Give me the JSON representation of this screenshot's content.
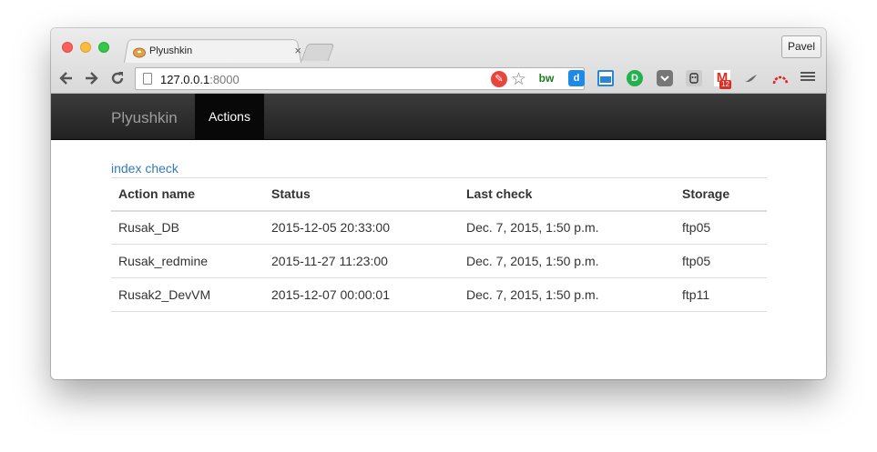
{
  "browser": {
    "tab_title": "Plyushkin",
    "tab_close": "×",
    "profile_name": "Pavel",
    "url_host": "127.0.0.1",
    "url_port": ":8000",
    "icons": {
      "back": "back-arrow-icon",
      "forward": "forward-arrow-icon",
      "reload": "reload-icon",
      "bookmark": "star-icon",
      "menu": "hamburger-menu-icon"
    },
    "extensions": {
      "bw_label": "bw",
      "d_label": "d",
      "circle_label": "D",
      "gmail_label": "M",
      "gmail_badge": "12"
    }
  },
  "navbar": {
    "brand": "Plyushkin",
    "active_item": "Actions"
  },
  "main": {
    "index_link": "index check",
    "table": {
      "columns": [
        "Action name",
        "Status",
        "Last check",
        "Storage"
      ],
      "rows": [
        [
          "Rusak_DB",
          "2015-12-05 20:33:00",
          "Dec. 7, 2015, 1:50 p.m.",
          "ftp05"
        ],
        [
          "Rusak_redmine",
          "2015-11-27 11:23:00",
          "Dec. 7, 2015, 1:50 p.m.",
          "ftp05"
        ],
        [
          "Rusak2_DevVM",
          "2015-12-07 00:00:01",
          "Dec. 7, 2015, 1:50 p.m.",
          "ftp11"
        ]
      ]
    }
  },
  "colors": {
    "navbar_bg": "#222222",
    "active_bg": "#080808",
    "link": "#337ab7",
    "brand_text": "#9d9d9d"
  }
}
